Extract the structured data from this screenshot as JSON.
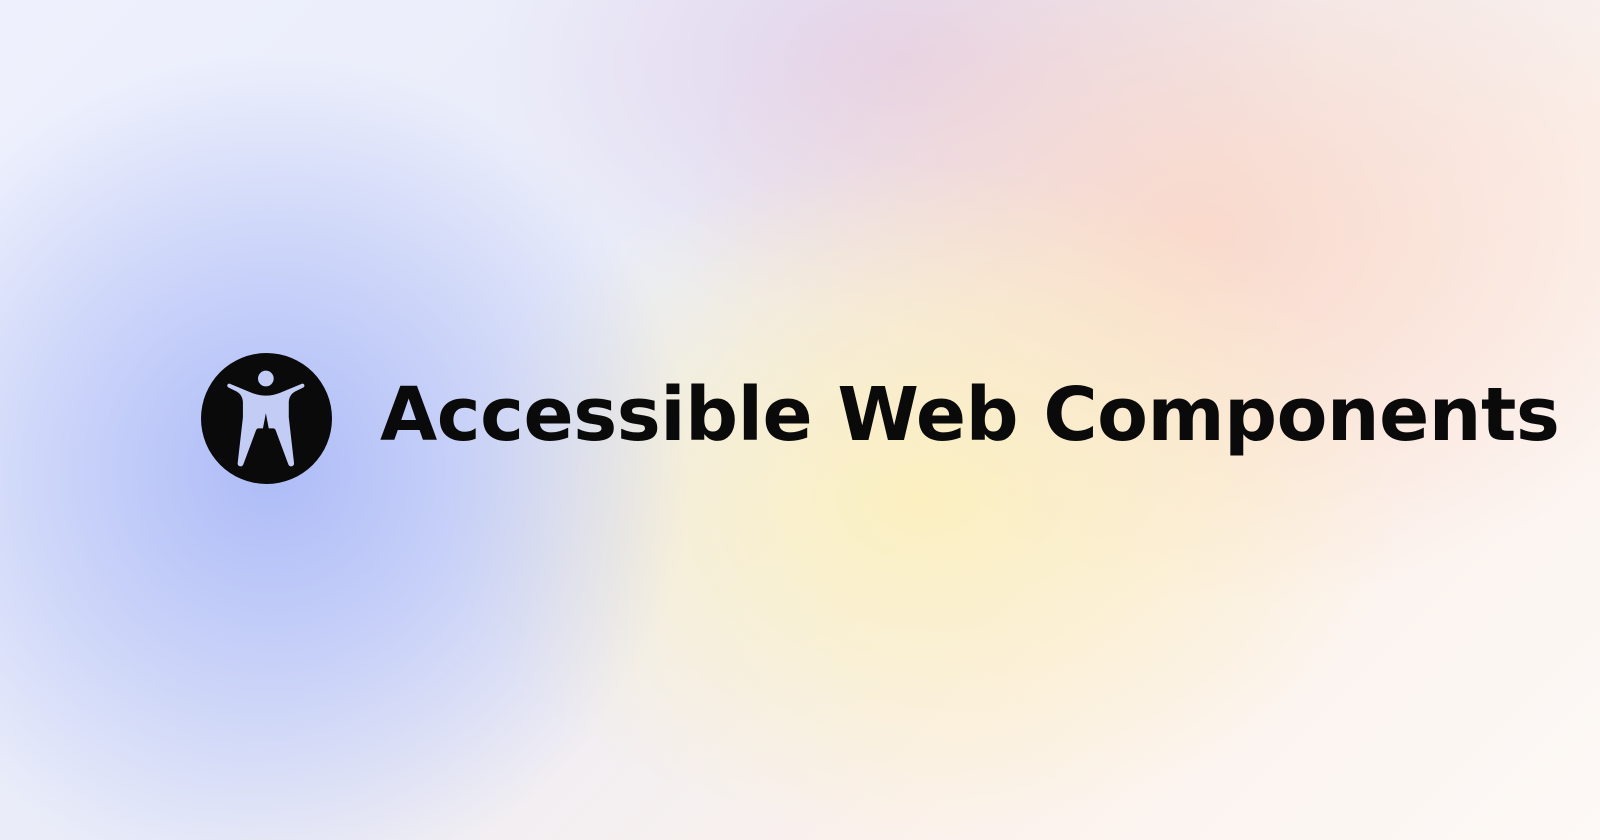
{
  "hero": {
    "logo_icon": "accessibility-icon",
    "title": "Accessible Web Components"
  },
  "colors": {
    "text": "#0a0a0a",
    "icon_fill": "#0a0a0a",
    "icon_figure": "#c3ccf5"
  }
}
